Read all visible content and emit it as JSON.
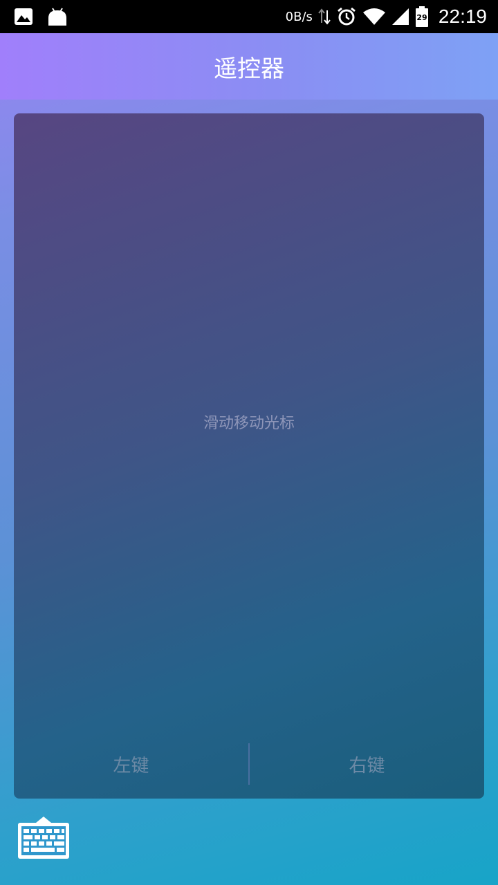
{
  "status_bar": {
    "net_speed": "0B/s",
    "battery_level": "29",
    "time": "22:19",
    "icons": [
      "image-icon",
      "android-icon",
      "data-transfer-icon",
      "alarm-icon",
      "wifi-icon",
      "signal-icon",
      "battery-icon"
    ]
  },
  "app_bar": {
    "title": "遥控器"
  },
  "touchpad": {
    "hint": "滑动移动光标",
    "left_button": "左键",
    "right_button": "右键"
  },
  "keyboard": {
    "icon": "keyboard-icon"
  },
  "colors": {
    "app_bar_start": "#a07ffb",
    "app_bar_end": "#7ea1f5",
    "touchpad_top": "#574682",
    "touchpad_bottom": "#1a5e7c",
    "background_bottom": "#17a4c8"
  }
}
